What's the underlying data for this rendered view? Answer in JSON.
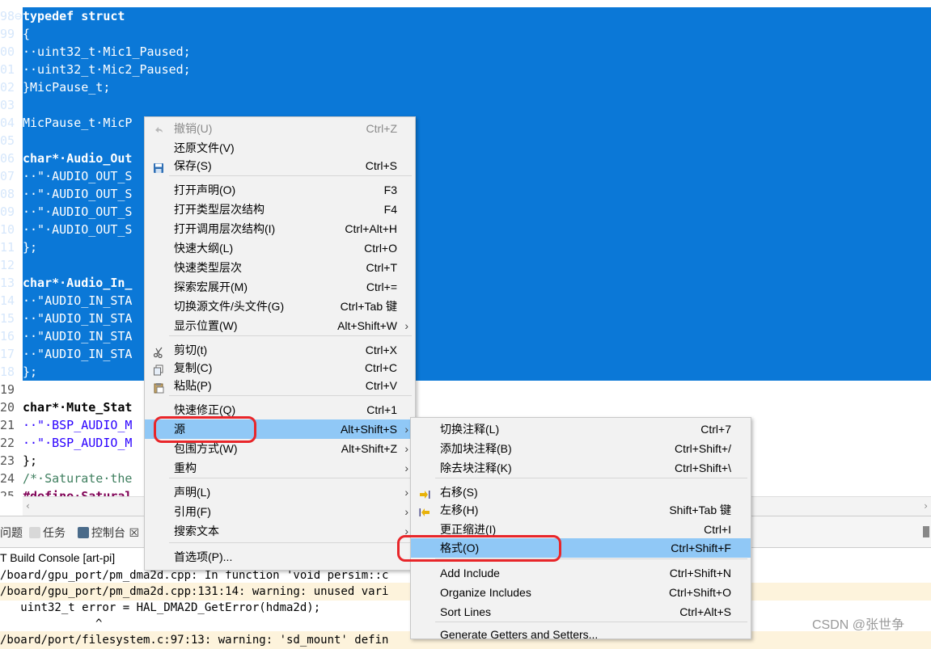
{
  "editor": {
    "lines": [
      {
        "num": "98⊖",
        "text": "typedef struct",
        "kw": true
      },
      {
        "num": "99",
        "text": "{"
      },
      {
        "num": "00",
        "text": "··uint32_t·Mic1_Paused;"
      },
      {
        "num": "01",
        "text": "··uint32_t·Mic2_Paused;"
      },
      {
        "num": "02",
        "text": "}MicPause_t;"
      },
      {
        "num": "03",
        "text": ""
      },
      {
        "num": "04",
        "text": "MicPause_t·MicP"
      },
      {
        "num": "05",
        "text": ""
      },
      {
        "num": "06",
        "text": "char*·Audio_Out"
      },
      {
        "num": "07",
        "text": "··\"·AUDIO_OUT_S"
      },
      {
        "num": "08",
        "text": "··\"·AUDIO_OUT_S"
      },
      {
        "num": "09",
        "text": "··\"·AUDIO_OUT_S"
      },
      {
        "num": "10",
        "text": "··\"·AUDIO_OUT_S"
      },
      {
        "num": "11",
        "text": "};"
      },
      {
        "num": "12",
        "text": ""
      },
      {
        "num": "13",
        "text": "char*·Audio_In_"
      },
      {
        "num": "14",
        "text": "··\"AUDIO_IN_STA"
      },
      {
        "num": "15",
        "text": "··\"AUDIO_IN_STA"
      },
      {
        "num": "16",
        "text": "··\"AUDIO_IN_STA"
      },
      {
        "num": "17",
        "text": "··\"AUDIO_IN_STA"
      },
      {
        "num": "18",
        "text": "};"
      },
      {
        "num": "19",
        "text": ""
      },
      {
        "num": "20",
        "text": "char*·Mute_Stat"
      },
      {
        "num": "21",
        "text": "··\"·BSP_AUDIO_M"
      },
      {
        "num": "22",
        "text": "··\"·BSP_AUDIO_M"
      },
      {
        "num": "23",
        "text": "};"
      },
      {
        "num": "24",
        "text": "/*·Saturate·the"
      },
      {
        "num": "25",
        "text": "#define·Satural"
      }
    ]
  },
  "views": {
    "tabs": [
      {
        "label": "问题"
      },
      {
        "label": "任务"
      },
      {
        "label": "控制台 ☒"
      }
    ],
    "console_title": "T Build Console [art-pi]",
    "console_lines": [
      {
        "text": "/board/gpu_port/pm_dma2d.cpp: In function 'void persim::c",
        "warn": false
      },
      {
        "text": "/board/gpu_port/pm_dma2d.cpp:131:14: warning: unused vari",
        "warn": true
      },
      {
        "text": "   uint32_t error = HAL_DMA2D_GetError(hdma2d);",
        "warn": false
      },
      {
        "text": "              ^",
        "warn": false
      },
      {
        "text": "/board/port/filesystem.c:97:13: warning: 'sd_mount' defin",
        "warn": true
      }
    ],
    "watermark": "CSDN @张世争"
  },
  "menu": {
    "items": [
      {
        "label": "撤销(U)",
        "accel": "Ctrl+Z",
        "disabled": true,
        "icon": "undo-icon"
      },
      {
        "label": "还原文件(V)",
        "accel": ""
      },
      {
        "label": "保存(S)",
        "accel": "Ctrl+S",
        "icon": "save-icon"
      },
      {
        "label": "打开声明(O)",
        "accel": "F3"
      },
      {
        "label": "打开类型层次结构",
        "accel": "F4"
      },
      {
        "label": "打开调用层次结构(I)",
        "accel": "Ctrl+Alt+H"
      },
      {
        "label": "快速大纲(L)",
        "accel": "Ctrl+O"
      },
      {
        "label": "快速类型层次",
        "accel": "Ctrl+T"
      },
      {
        "label": "探索宏展开(M)",
        "accel": "Ctrl+="
      },
      {
        "label": "切换源文件/头文件(G)",
        "accel": "Ctrl+Tab 键"
      },
      {
        "label": "显示位置(W)",
        "accel": "Alt+Shift+W",
        "sub": true
      },
      {
        "label": "剪切(t)",
        "accel": "Ctrl+X",
        "icon": "cut-icon"
      },
      {
        "label": "复制(C)",
        "accel": "Ctrl+C",
        "icon": "copy-icon"
      },
      {
        "label": "粘贴(P)",
        "accel": "Ctrl+V",
        "icon": "paste-icon"
      },
      {
        "label": "快速修正(Q)",
        "accel": "Ctrl+1"
      },
      {
        "label": "源",
        "accel": "Alt+Shift+S",
        "sub": true,
        "highlighted": true
      },
      {
        "label": "包围方式(W)",
        "accel": "Alt+Shift+Z",
        "sub": true
      },
      {
        "label": "重构",
        "accel": "",
        "sub": true
      },
      {
        "label": "声明(L)",
        "accel": "",
        "sub": true
      },
      {
        "label": "引用(F)",
        "accel": "",
        "sub": true
      },
      {
        "label": "搜索文本",
        "accel": "",
        "sub": true
      },
      {
        "label": "首选项(P)...",
        "accel": ""
      }
    ]
  },
  "submenu": {
    "items": [
      {
        "label": "切换注释(L)",
        "accel": "Ctrl+7"
      },
      {
        "label": "添加块注释(B)",
        "accel": "Ctrl+Shift+/"
      },
      {
        "label": "除去块注释(K)",
        "accel": "Ctrl+Shift+\\"
      },
      {
        "label": "右移(S)",
        "accel": "",
        "icon": "shift-right-icon"
      },
      {
        "label": "左移(H)",
        "accel": "Shift+Tab 键",
        "icon": "shift-left-icon"
      },
      {
        "label": "更正缩进(I)",
        "accel": "Ctrl+I"
      },
      {
        "label": "格式(O)",
        "accel": "Ctrl+Shift+F",
        "highlighted": true
      },
      {
        "label": "Add Include",
        "accel": "Ctrl+Shift+N"
      },
      {
        "label": "Organize Includes",
        "accel": "Ctrl+Shift+O"
      },
      {
        "label": "Sort Lines",
        "accel": "Ctrl+Alt+S"
      },
      {
        "label": "Generate Getters and Setters...",
        "accel": ""
      }
    ]
  }
}
